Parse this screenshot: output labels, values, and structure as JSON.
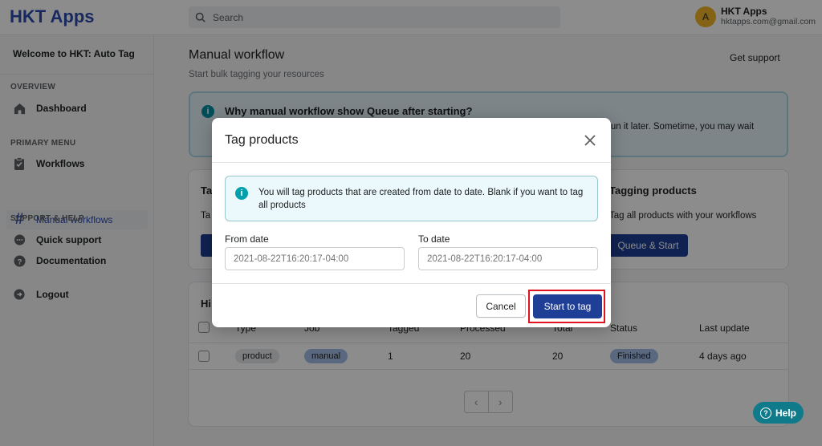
{
  "app": {
    "logo": "HKT Apps"
  },
  "search": {
    "placeholder": "Search"
  },
  "user": {
    "initial": "A",
    "name": "HKT Apps",
    "email": "hktapps.com@gmail.com"
  },
  "sidebar": {
    "welcome": "Welcome to HKT: Auto Tag",
    "sections": [
      {
        "label": "OVERVIEW"
      },
      {
        "label": "PRIMARY MENU"
      },
      {
        "label": "SUPPORT & HELP"
      }
    ],
    "items": [
      {
        "label": "Dashboard",
        "icon": "home-icon"
      },
      {
        "label": "Workflows",
        "icon": "clipboard-icon"
      },
      {
        "label": "Manual workflows",
        "icon": "hash-icon",
        "active": true
      },
      {
        "label": "Quick support",
        "icon": "chat-icon"
      },
      {
        "label": "Documentation",
        "icon": "question-icon"
      },
      {
        "label": "Logout",
        "icon": "logout-icon"
      }
    ]
  },
  "page": {
    "title": "Manual workflow",
    "subtitle": "Start bulk tagging your resources",
    "get_support": "Get support"
  },
  "banner": {
    "title": "Why manual workflow show Queue after starting?",
    "text_visible": "run it later. Sometime, you may wait"
  },
  "cards": {
    "left_title": "Ta",
    "left_text": "Ta",
    "tagging_title": "Tagging products",
    "tagging_text": "Tag all products with your workflows",
    "queue_button": "Queue & Start"
  },
  "history": {
    "title": "Hi",
    "columns": [
      "Type",
      "Job",
      "Tagged",
      "Processed",
      "Total",
      "Status",
      "Last update"
    ],
    "rows": [
      {
        "type": "product",
        "job": "manual",
        "tagged": "1",
        "processed": "20",
        "total": "20",
        "status": "Finished",
        "last_update": "4 days ago"
      }
    ]
  },
  "help": {
    "label": "Help"
  },
  "modal": {
    "title": "Tag products",
    "info": "You will tag products that are created from date to date. Blank if you want to tag all products",
    "from_label": "From date",
    "from_placeholder": "2021-08-22T16:20:17-04:00",
    "to_label": "To date",
    "to_placeholder": "2021-08-22T16:20:17-04:00",
    "cancel": "Cancel",
    "start": "Start to tag"
  },
  "colors": {
    "primary": "#1e3f95",
    "highlight": "#e0141e",
    "info": "#00a0ac",
    "help": "#0f7b8a"
  }
}
